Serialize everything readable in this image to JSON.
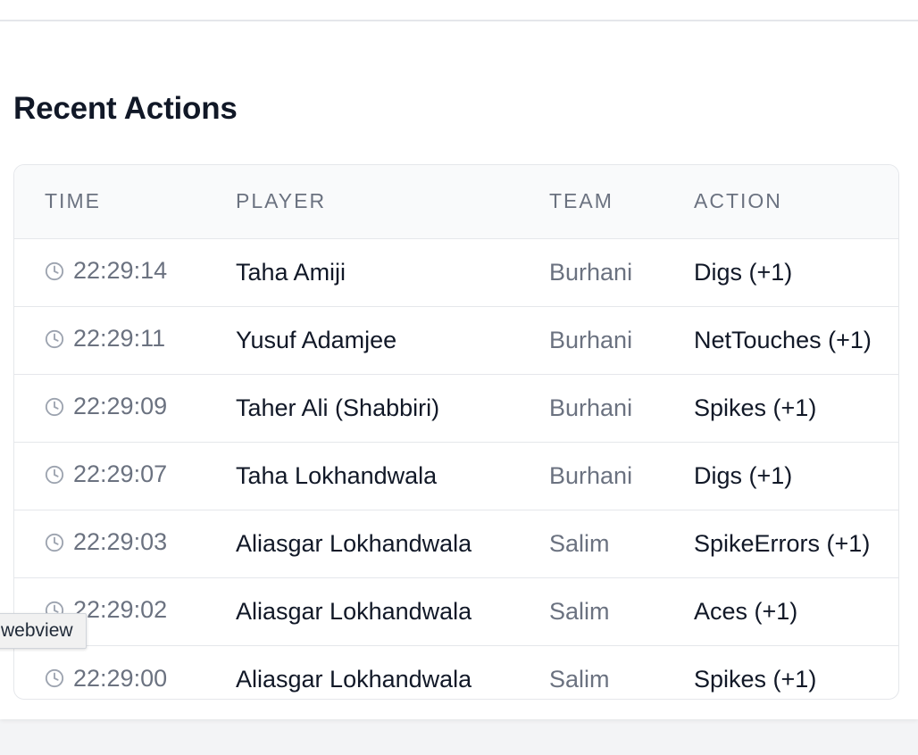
{
  "section": {
    "title": "Recent Actions"
  },
  "table": {
    "headers": {
      "time": "TIME",
      "player": "PLAYER",
      "team": "TEAM",
      "action": "ACTION"
    },
    "rows": [
      {
        "time": "22:29:14",
        "player": "Taha Amiji",
        "team": "Burhani",
        "action": "Digs (+1)"
      },
      {
        "time": "22:29:11",
        "player": "Yusuf Adamjee",
        "team": "Burhani",
        "action": "NetTouches (+1)"
      },
      {
        "time": "22:29:09",
        "player": "Taher Ali (Shabbiri)",
        "team": "Burhani",
        "action": "Spikes (+1)"
      },
      {
        "time": "22:29:07",
        "player": "Taha Lokhandwala",
        "team": "Burhani",
        "action": "Digs (+1)"
      },
      {
        "time": "22:29:03",
        "player": "Aliasgar Lokhandwala",
        "team": "Salim",
        "action": "SpikeErrors (+1)"
      },
      {
        "time": "22:29:02",
        "player": "Aliasgar Lokhandwala",
        "team": "Salim",
        "action": "Aces (+1)"
      },
      {
        "time": "22:29:00",
        "player": "Aliasgar Lokhandwala",
        "team": "Salim",
        "action": "Spikes (+1)"
      }
    ]
  },
  "tooltip": {
    "text": "webview"
  },
  "icons": {
    "time_icon": "clock-icon"
  },
  "colors": {
    "header_bg": "#f9fafb",
    "muted_text": "#6b7280",
    "primary_text": "#111827",
    "border": "#e5e7eb"
  }
}
